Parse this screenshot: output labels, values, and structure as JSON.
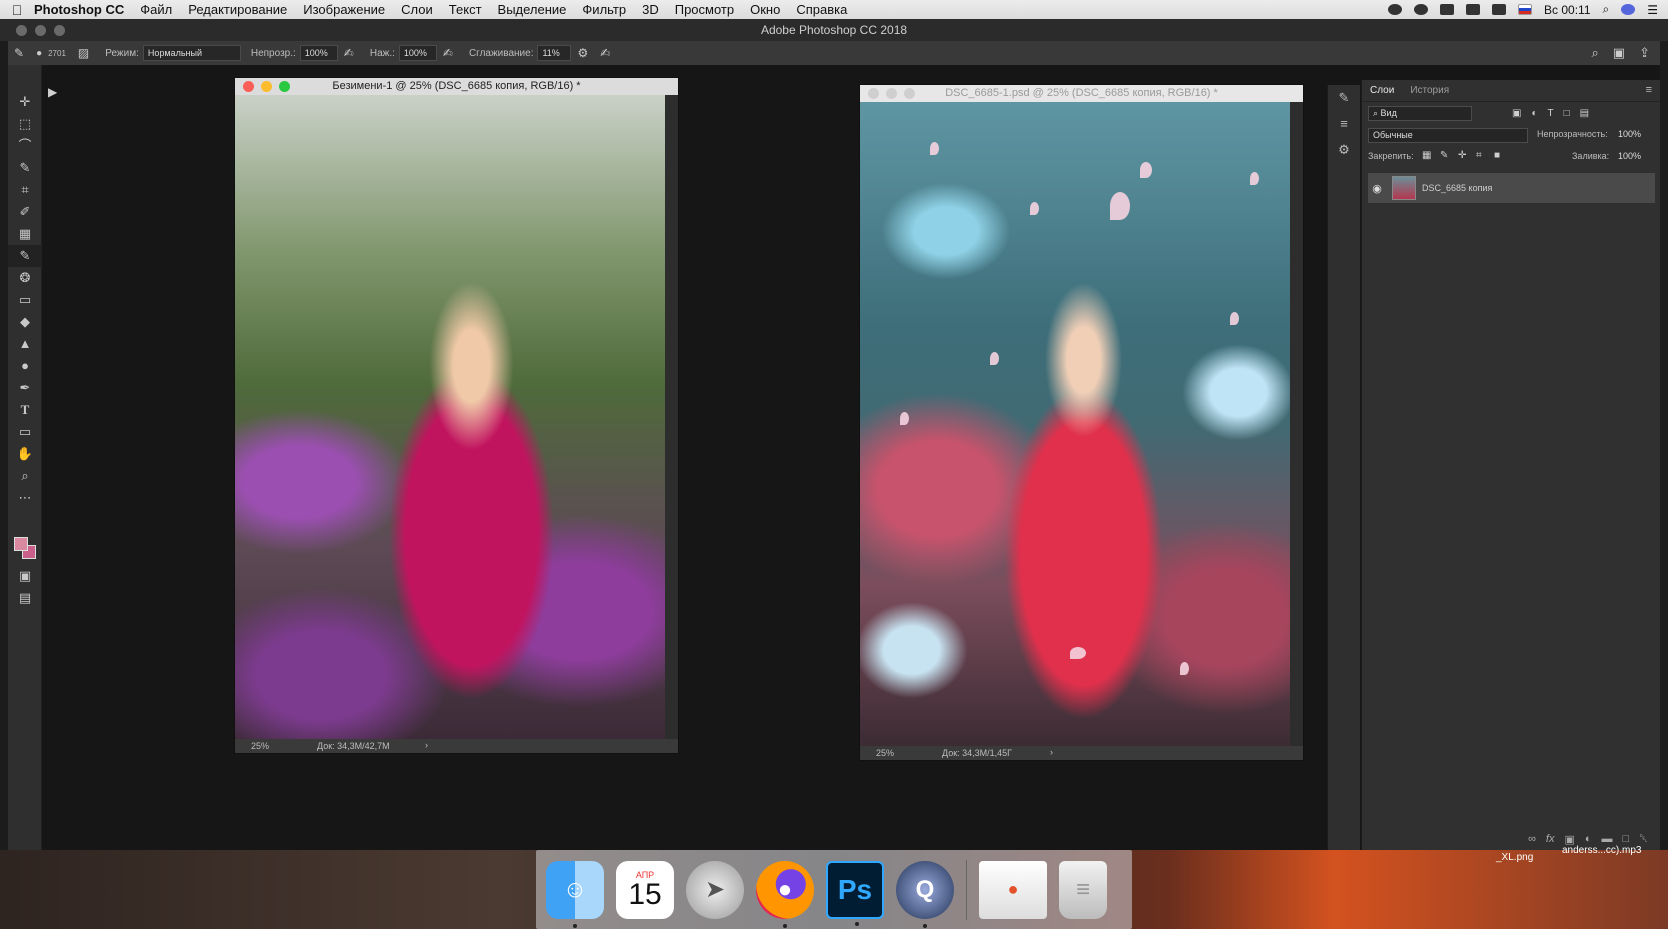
{
  "menubar": {
    "app_name": "Photoshop CC",
    "items": [
      "Файл",
      "Редактирование",
      "Изображение",
      "Слои",
      "Текст",
      "Выделение",
      "Фильтр",
      "3D",
      "Просмотр",
      "Окно",
      "Справка"
    ],
    "clock": "Вс 00:11"
  },
  "window_title": "Adobe Photoshop CC 2018",
  "options": {
    "brush_size": "2701",
    "mode_label": "Режим:",
    "mode_value": "Нормальный",
    "opacity_label": "Непрозр.:",
    "opacity_value": "100%",
    "pressure_label": "Наж.:",
    "pressure_value": "100%",
    "smoothing_label": "Сглаживание:",
    "smoothing_value": "11%"
  },
  "docs": [
    {
      "title": "Безимени-1 @ 25% (DSC_6685 копия, RGB/16) *",
      "zoom": "25%",
      "size": "Док: 34,3M/42,7M"
    },
    {
      "title": "DSC_6685-1.psd @ 25% (DSC_6685 копия, RGB/16) *",
      "zoom": "25%",
      "size": "Док: 34,3M/1,45Г"
    }
  ],
  "layers": {
    "tabs": [
      "Слои",
      "История"
    ],
    "filter": "Вид",
    "blend": "Обычные",
    "opacity_label": "Непрозрачность:",
    "opacity_value": "100%",
    "lock_label": "Закрепить:",
    "fill_label": "Заливка:",
    "fill_value": "100%",
    "layer_name": "DSC_6685 копия"
  },
  "dock": {
    "calendar_month": "АПР",
    "calendar_day": "15",
    "ps_label": "Ps"
  },
  "desktop": {
    "file1": "_XL.png",
    "file2": "anderss...cc).mp3"
  }
}
